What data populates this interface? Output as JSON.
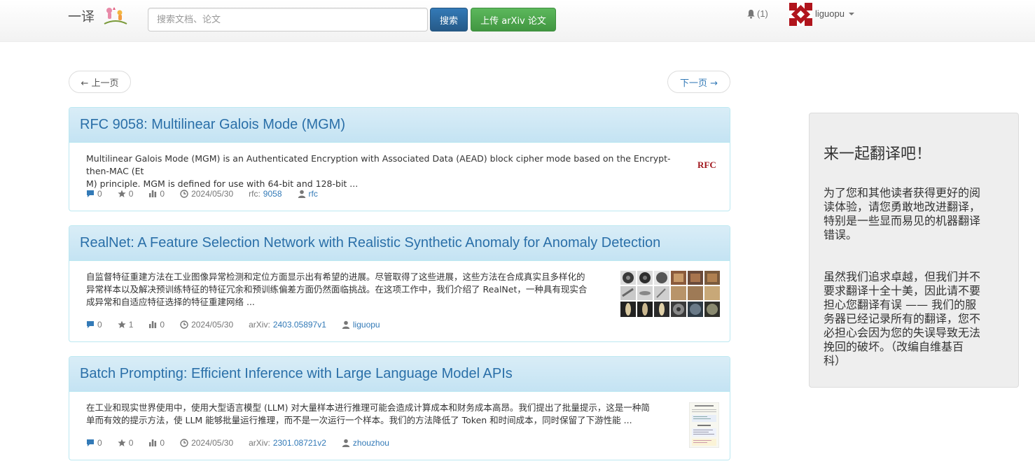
{
  "brand": {
    "name": "一译"
  },
  "search": {
    "placeholder": "搜索文档、论文",
    "button": "搜索",
    "upload": "上传 arXiv 论文"
  },
  "notifications": {
    "count": "(1)"
  },
  "user": {
    "name": "liguopu"
  },
  "pager": {
    "prev": "← 上一页",
    "next": "下一页 →"
  },
  "papers": [
    {
      "title": "RFC 9058: Multilinear Galois Mode (MGM)",
      "desc_line1": "Multilinear Galois Mode (MGM) is an Authenticated Encryption with Associated Data (AEAD) block cipher mode based on the Encrypt-then-MAC (Et",
      "desc_line2": "M) principle. MGM is defined for use with 64-bit and 128-bit ...",
      "comments": "0",
      "stars": "0",
      "views": "0",
      "date": "2024/05/30",
      "source_prefix": "rfc:",
      "source_id": "9058",
      "uploader": "rfc",
      "thumb_label": "RFC"
    },
    {
      "title": "RealNet: A Feature Selection Network with Realistic Synthetic Anomaly for Anomaly Detection",
      "desc_line1": "自监督特征重建方法在工业图像异常检测和定位方面显示出有希望的进展。尽管取得了这些进展，这些方法在合成真实且多样化的",
      "desc_line2": "异常样本以及解决预训练特征的特征冗余和预训练偏差方面仍然面临挑战。在这项工作中，我们介绍了 RealNet，一种具有现实合",
      "desc_line3": "成异常和自适应特征选择的特征重建网络 ...",
      "comments": "0",
      "stars": "1",
      "views": "0",
      "date": "2024/05/30",
      "source_prefix": "arXiv:",
      "source_id": "2403.05897v1",
      "uploader": "liguopu"
    },
    {
      "title": "Batch Prompting: Efficient Inference with Large Language Model APIs",
      "desc_line1": "在工业和现实世界使用中，使用大型语言模型 (LLM) 对大量样本进行推理可能会造成计算成本和财务成本高昂。我们提出了批量提示，这是一种简",
      "desc_line2": "单而有效的提示方法，使 LLM 能够批量运行推理，而不是一次运行一个样本。我们的方法降低了 Token 和时间成本，同时保留了下游性能 ...",
      "comments": "0",
      "stars": "0",
      "views": "0",
      "date": "2024/05/30",
      "source_prefix": "arXiv:",
      "source_id": "2301.08721v2",
      "uploader": "zhouzhou"
    }
  ],
  "sidebar": {
    "title": "来一起翻译吧！",
    "p1_line1": "为了您和其他读者获得更好的阅",
    "p1_line2": "读体验，请您勇敢地改进翻译，",
    "p1_line3": "特别是一些显而易见的机器翻译",
    "p1_line4": "错误。",
    "p2_line1": "虽然我们追求卓越，但我们并不",
    "p2_line2": "要求翻译十全十美，因此请不要",
    "p2_line3": "担心您翻译有误 —— 我们的服",
    "p2_line4": "务器已经记录所有的翻译，您不",
    "p2_line5": "必担心会因为您的失误导致无法",
    "p2_line6": "挽回的破坏。（改编自维基百",
    "p2_line7": "科）"
  },
  "colors": {
    "primary": "#337ab7",
    "success": "#5cb85c",
    "panel_head": "#d9edf7",
    "title": "#2a6fa8",
    "rfc": "#a0161c"
  }
}
